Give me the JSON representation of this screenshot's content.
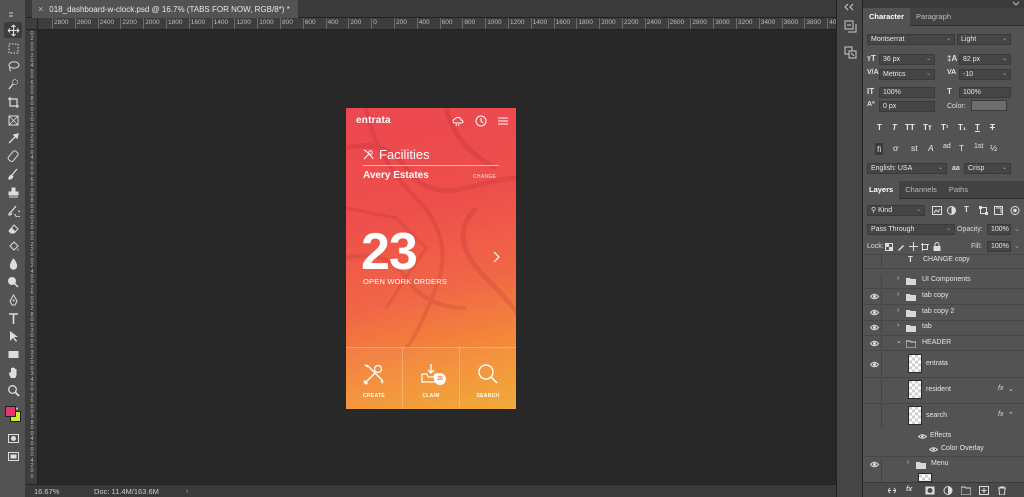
{
  "document": {
    "tab_title": "018_dashboard-w-clock.psd @ 16.7% (TABS FOR NOW, RGB/8*) *",
    "close_glyph": "×"
  },
  "rulers": {
    "horizontal": [
      "2800",
      "2600",
      "2400",
      "2200",
      "2000",
      "1800",
      "1600",
      "1400",
      "1200",
      "1000",
      "800",
      "600",
      "400",
      "200",
      "0",
      "200",
      "400",
      "600",
      "800",
      "1000",
      "1200",
      "1400",
      "1600",
      "1800",
      "2000",
      "2200",
      "2400",
      "2600",
      "2800",
      "3000",
      "3200",
      "3400",
      "3600",
      "3800",
      "4000"
    ],
    "vertical": [
      "0",
      "2",
      "0",
      "0",
      "2",
      "0",
      "4",
      "0",
      "0",
      "6",
      "0",
      "0",
      "8",
      "0",
      "0",
      "1",
      "0",
      "0",
      "0",
      "2",
      "0",
      "0",
      "0",
      "4",
      "0",
      "0",
      "0",
      "6",
      "0",
      "0",
      "0",
      "8",
      "0",
      "0",
      "0",
      "2",
      "0",
      "0",
      "0",
      "2",
      "2",
      "0",
      "0",
      "2",
      "4",
      "0",
      "0",
      "2",
      "6",
      "0",
      "0",
      "2",
      "8",
      "0",
      "0",
      "3",
      "0",
      "0",
      "0",
      "3",
      "2",
      "0",
      "0",
      "3",
      "4",
      "0",
      "0",
      "3",
      "6",
      "0",
      "0",
      "3",
      "8",
      "0",
      "0",
      "4",
      "0",
      "0",
      "0",
      "4",
      "2",
      "0",
      "0"
    ]
  },
  "artboard": {
    "logo": "entrata",
    "section_title": "Facilities",
    "property_name": "Avery Estates",
    "change_label": "CHANGE",
    "count": "23",
    "count_label": "OPEN WORK ORDERS",
    "actions": [
      {
        "label": "CREATE",
        "icon": "tools-icon"
      },
      {
        "label": "CLAIM",
        "icon": "claim-tray-icon",
        "badge": "20"
      },
      {
        "label": "SEARCH",
        "icon": "search-icon"
      }
    ],
    "gradient_top": "#ec4751",
    "gradient_bottom": "#f2a830"
  },
  "status": {
    "zoom": "16.67%",
    "doc": "Doc: 11.4M/163.6M",
    "arrow": "›"
  },
  "character_panel": {
    "tabs": [
      "Character",
      "Paragraph"
    ],
    "font_family": "Montserrat",
    "font_style": "Light",
    "font_size": "36 px",
    "leading": "82 px",
    "kerning": "Metrics",
    "tracking": "-10",
    "vertical_scale": "100%",
    "horizontal_scale": "100%",
    "baseline_shift": "0 px",
    "color_label": "Color:",
    "language": "English: USA",
    "aa_label": "aa",
    "antialias": "Crisp",
    "type_buttons": [
      "T",
      "T",
      "TT",
      "Tт",
      "T¹",
      "T₁",
      "T",
      "T"
    ],
    "opentype_buttons": [
      "fi",
      "ơ",
      "st",
      "A",
      "ad",
      "T",
      "1st",
      "½"
    ]
  },
  "layers_panel": {
    "tabs": [
      "Layers",
      "Channels",
      "Paths"
    ],
    "filter": "Kind",
    "blend_mode": "Pass Through",
    "opacity_label": "Opacity:",
    "opacity": "100%",
    "lock_label": "Lock:",
    "fill_label": "Fill:",
    "fill": "100%",
    "layers": [
      {
        "name": "CHANGE copy",
        "type": "text",
        "visible": false
      },
      {
        "name": "UI Components",
        "type": "group",
        "visible": false
      },
      {
        "name": "tab copy",
        "type": "group",
        "visible": true
      },
      {
        "name": "tab copy 2",
        "type": "group",
        "visible": true
      },
      {
        "name": "tab",
        "type": "group",
        "visible": true
      },
      {
        "name": "HEADER",
        "type": "group-open",
        "visible": true
      },
      {
        "name": "entrata",
        "type": "layer",
        "visible": true
      },
      {
        "name": "resident",
        "type": "layer",
        "visible": false,
        "fx": "fx"
      },
      {
        "name": "search",
        "type": "layer",
        "visible": false,
        "fx": "fx"
      },
      {
        "name": "Effects",
        "type": "effects",
        "visible": true
      },
      {
        "name": "Color Overlay",
        "type": "effect",
        "visible": true
      },
      {
        "name": "Menu",
        "type": "group",
        "visible": true
      }
    ]
  },
  "colors": {
    "foreground": "#e8336b",
    "background": "#d7e62b"
  }
}
